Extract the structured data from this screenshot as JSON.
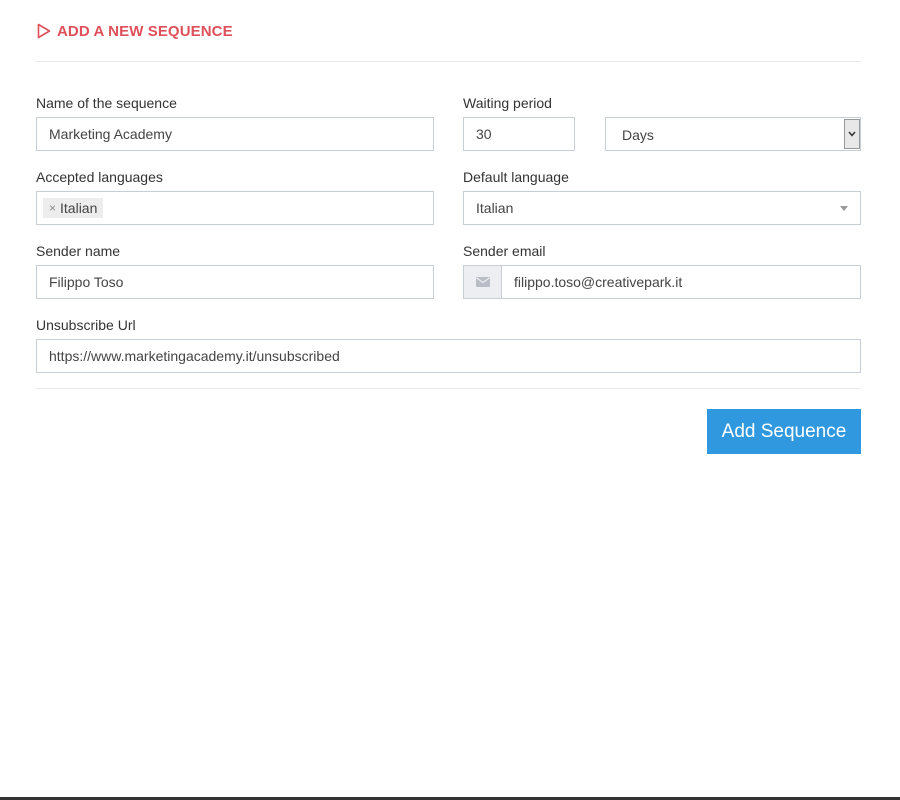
{
  "header": {
    "title": "ADD A NEW SEQUENCE",
    "icon": "play-outline-icon",
    "accent": "#e0505a"
  },
  "form": {
    "name": {
      "label": "Name of the sequence",
      "value": "Marketing Academy"
    },
    "waiting": {
      "label": "Waiting period",
      "value": "30",
      "unit": "Days"
    },
    "accepted": {
      "label": "Accepted languages",
      "tags": [
        "Italian"
      ]
    },
    "default_lang": {
      "label": "Default language",
      "value": "Italian"
    },
    "sender_name": {
      "label": "Sender name",
      "value": "Filippo Toso"
    },
    "sender_email": {
      "label": "Sender email",
      "value": "filippo.toso@creativepark.it",
      "icon": "envelope-icon"
    },
    "unsubscribe": {
      "label": "Unsubscribe Url",
      "value": "https://www.marketingacademy.it/unsubscribed"
    }
  },
  "submit": {
    "label": "Add Sequence",
    "color": "#2f98de"
  }
}
